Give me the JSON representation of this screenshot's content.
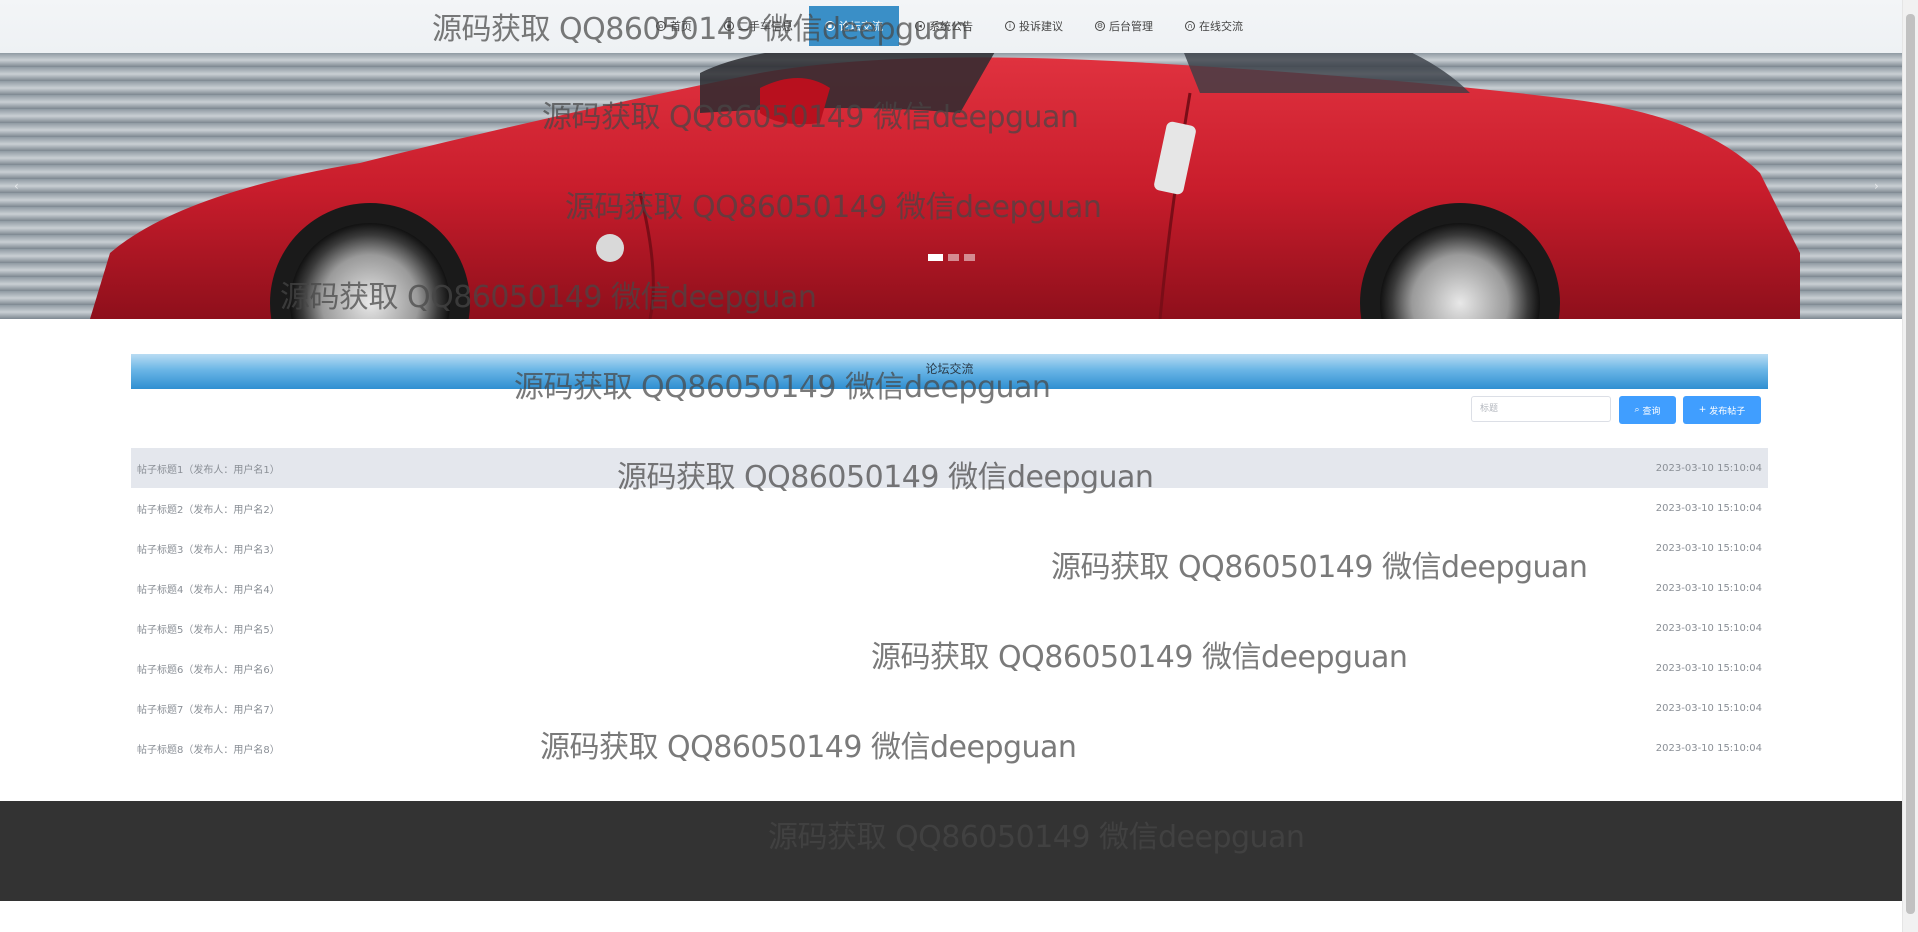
{
  "nav": {
    "items": [
      {
        "label": "首页",
        "icon": "home-icon"
      },
      {
        "label": "二手车信息",
        "icon": "car-icon"
      },
      {
        "label": "论坛交流",
        "icon": "forum-icon",
        "active": true
      },
      {
        "label": "系统公告",
        "icon": "megaphone-icon"
      },
      {
        "label": "投诉建议",
        "icon": "info-icon"
      },
      {
        "label": "后台管理",
        "icon": "settings-icon"
      },
      {
        "label": "在线交流",
        "icon": "headset-icon"
      }
    ],
    "active_color": "#3a8fc7"
  },
  "banner": {
    "slides": 3,
    "active_slide": 1,
    "prev_arrow": "‹",
    "next_arrow": "›"
  },
  "forum": {
    "title": "论坛交流",
    "search_placeholder": "标题",
    "search_button": "查询",
    "post_button": "发布帖子",
    "accent_color": "#409eff",
    "posts": [
      {
        "title": "帖子标题1（发布人：用户名1）",
        "time": "2023-03-10 15:10:04"
      },
      {
        "title": "帖子标题2（发布人：用户名2）",
        "time": "2023-03-10 15:10:04"
      },
      {
        "title": "帖子标题3（发布人：用户名3）",
        "time": "2023-03-10 15:10:04"
      },
      {
        "title": "帖子标题4（发布人：用户名4）",
        "time": "2023-03-10 15:10:04"
      },
      {
        "title": "帖子标题5（发布人：用户名5）",
        "time": "2023-03-10 15:10:04"
      },
      {
        "title": "帖子标题6（发布人：用户名6）",
        "time": "2023-03-10 15:10:04"
      },
      {
        "title": "帖子标题7（发布人：用户名7）",
        "time": "2023-03-10 15:10:04"
      },
      {
        "title": "帖子标题8（发布人：用户名8）",
        "time": "2023-03-10 15:10:04"
      }
    ]
  },
  "watermark": {
    "text": "源码获取 QQ86050149 微信deepguan"
  },
  "footer": {
    "color": "#333333"
  }
}
